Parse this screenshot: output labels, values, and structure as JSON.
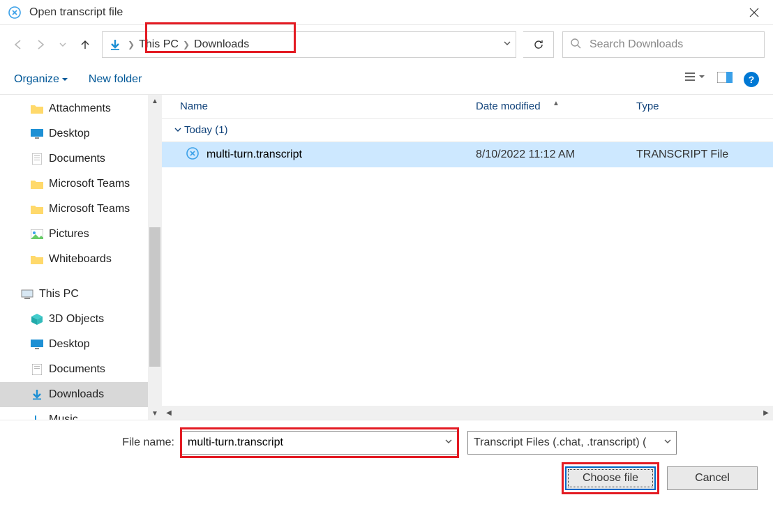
{
  "title": "Open transcript file",
  "breadcrumb": {
    "items": [
      "This PC",
      "Downloads"
    ]
  },
  "search": {
    "placeholder": "Search Downloads"
  },
  "toolbar": {
    "organize": "Organize",
    "new_folder": "New folder"
  },
  "sidebar": {
    "items": [
      {
        "label": "Attachments",
        "icon": "folder"
      },
      {
        "label": "Desktop",
        "icon": "desktop"
      },
      {
        "label": "Documents",
        "icon": "document"
      },
      {
        "label": "Microsoft Teams",
        "icon": "folder"
      },
      {
        "label": "Microsoft Teams",
        "icon": "folder"
      },
      {
        "label": "Pictures",
        "icon": "pictures"
      },
      {
        "label": "Whiteboards",
        "icon": "folder"
      }
    ],
    "root": {
      "label": "This PC"
    },
    "children": [
      {
        "label": "3D Objects",
        "icon": "3d"
      },
      {
        "label": "Desktop",
        "icon": "desktop"
      },
      {
        "label": "Documents",
        "icon": "document"
      },
      {
        "label": "Downloads",
        "icon": "down-arrow",
        "selected": true
      },
      {
        "label": "Music",
        "icon": "music"
      }
    ]
  },
  "columns": {
    "name": "Name",
    "date": "Date modified",
    "type": "Type"
  },
  "group": {
    "label": "Today (1)"
  },
  "files": [
    {
      "name": "multi-turn.transcript",
      "date": "8/10/2022 11:12 AM",
      "type": "TRANSCRIPT File",
      "selected": true
    }
  ],
  "footer": {
    "filename_label": "File name:",
    "filename_value": "multi-turn.transcript",
    "filter": "Transcript Files (.chat, .transcript) (",
    "choose": "Choose file",
    "cancel": "Cancel"
  }
}
